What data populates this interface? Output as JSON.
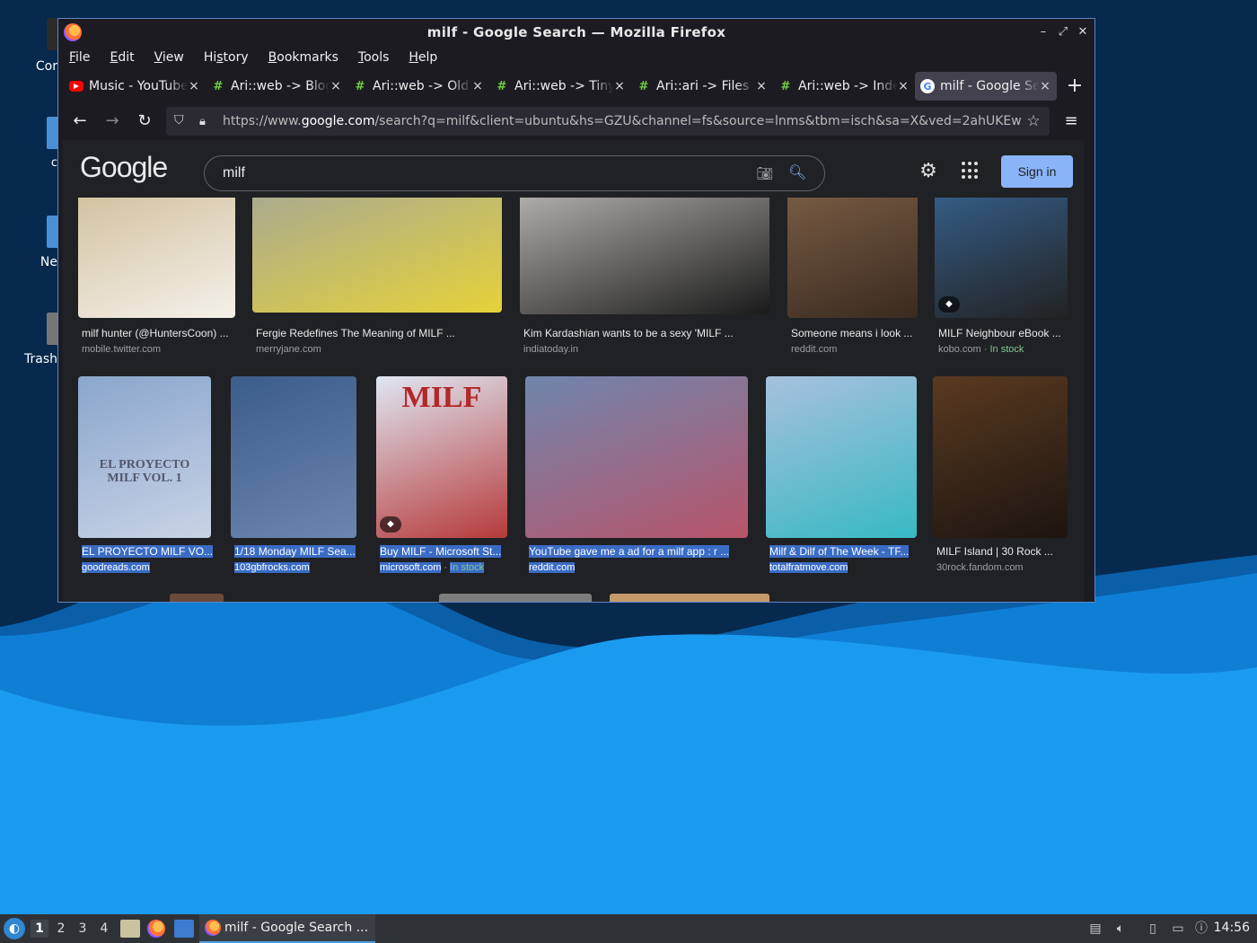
{
  "desktop": {
    "icons": [
      {
        "label": "Cor"
      },
      {
        "label": "c"
      },
      {
        "label": "Ne"
      },
      {
        "label": "Trash"
      }
    ]
  },
  "window": {
    "title": "milf - Google Search — Mozilla Firefox",
    "controls": {
      "minimize": "–",
      "maximize": "⤢",
      "close": "✕"
    }
  },
  "menubar": {
    "items": [
      {
        "label": "File",
        "accel": "F",
        "rest": "ile"
      },
      {
        "label": "Edit",
        "accel": "E",
        "rest": "dit"
      },
      {
        "label": "View",
        "accel": "V",
        "rest": "iew"
      },
      {
        "label": "History",
        "pre": "Hi",
        "accel": "s",
        "rest": "tory"
      },
      {
        "label": "Bookmarks",
        "accel": "B",
        "rest": "ookmarks"
      },
      {
        "label": "Tools",
        "accel": "T",
        "rest": "ools"
      },
      {
        "label": "Help",
        "accel": "H",
        "rest": "elp"
      }
    ]
  },
  "tabs": [
    {
      "label": "Music - YouTube",
      "icon": "youtube-icon",
      "active": false
    },
    {
      "label": "Ari::web -> Blog",
      "icon": "hash-icon",
      "active": false
    },
    {
      "label": "Ari::web -> Old",
      "icon": "hash-icon",
      "active": false
    },
    {
      "label": "Ari::web -> Tiny",
      "icon": "hash-icon",
      "active": false
    },
    {
      "label": "Ari::ari -> Files",
      "icon": "hash-icon",
      "active": false
    },
    {
      "label": "Ari::web -> Index",
      "icon": "hash-icon",
      "active": false
    },
    {
      "label": "milf - Google Search",
      "icon": "google-icon",
      "active": true
    }
  ],
  "navbar": {
    "url_prefix": "https://www.",
    "url_domain": "google.com",
    "url_rest": "/search?q=milf&client=ubuntu&hs=GZU&channel=fs&source=lnms&tbm=isch&sa=X&ved=2ahUKEw"
  },
  "google": {
    "logo": "Google",
    "query": "milf",
    "signin_label": "Sign in"
  },
  "results": {
    "row1": [
      {
        "title": "milf hunter (@HuntersCoon) ...",
        "source": "mobile.twitter.com",
        "stock": "",
        "color1": "#c9b48a",
        "color2": "#f4f1ea"
      },
      {
        "title": "Fergie Redefines The Meaning of MILF ...",
        "source": "merryjane.com",
        "stock": "",
        "color1": "#9aa0a6",
        "color2": "#e5d23a"
      },
      {
        "title": "Kim Kardashian wants to be a sexy 'MILF ...",
        "source": "indiatoday.in",
        "stock": "",
        "color1": "#d7d4cf",
        "color2": "#1a1a1a"
      },
      {
        "title": "Someone means i look ...",
        "source": "reddit.com",
        "stock": "",
        "color1": "#8a6a4e",
        "color2": "#3b2a20"
      },
      {
        "title": "MILF Neighbour eBook ...",
        "source": "kobo.com",
        "stock": "In stock",
        "color1": "#3a6fa6",
        "color2": "#222"
      }
    ],
    "row2": [
      {
        "title": "EL PROYECTO MILF VO...",
        "source": "goodreads.com",
        "stock": "",
        "selected": true,
        "overlay": "EL PROYECTO MILF VOL. 1",
        "color1": "#8aa6cc",
        "color2": "#c9d3e6"
      },
      {
        "title": "1/18 Monday MILF Sea...",
        "source": "103gbfrocks.com",
        "stock": "",
        "selected": true,
        "color1": "#3c5c8a",
        "color2": "#6b86b0"
      },
      {
        "title": "Buy MILF - Microsoft St...",
        "source": "microsoft.com",
        "stock": "In stock",
        "selected": true,
        "overlay": "MILF",
        "color1": "#dfe7f3",
        "color2": "#b63a3a"
      },
      {
        "title": "YouTube gave me a ad for a milf app : r ...",
        "source": "reddit.com",
        "stock": "",
        "selected": true,
        "color1": "#6f86ad",
        "color2": "#b8546a"
      },
      {
        "title": "Milf & Dilf of The Week - TF...",
        "source": "totalfratmove.com",
        "stock": "",
        "selected": true,
        "color1": "#a8c0dd",
        "color2": "#37b9c4"
      },
      {
        "title": "MILF Island | 30 Rock ...",
        "source": "30rock.fandom.com",
        "stock": "",
        "selected": false,
        "color1": "#5a3a20",
        "color2": "#1c1410"
      }
    ]
  },
  "taskbar": {
    "workspaces": [
      "1",
      "2",
      "3",
      "4"
    ],
    "active_task": "milf - Google Search ...",
    "clock": "14:56"
  }
}
